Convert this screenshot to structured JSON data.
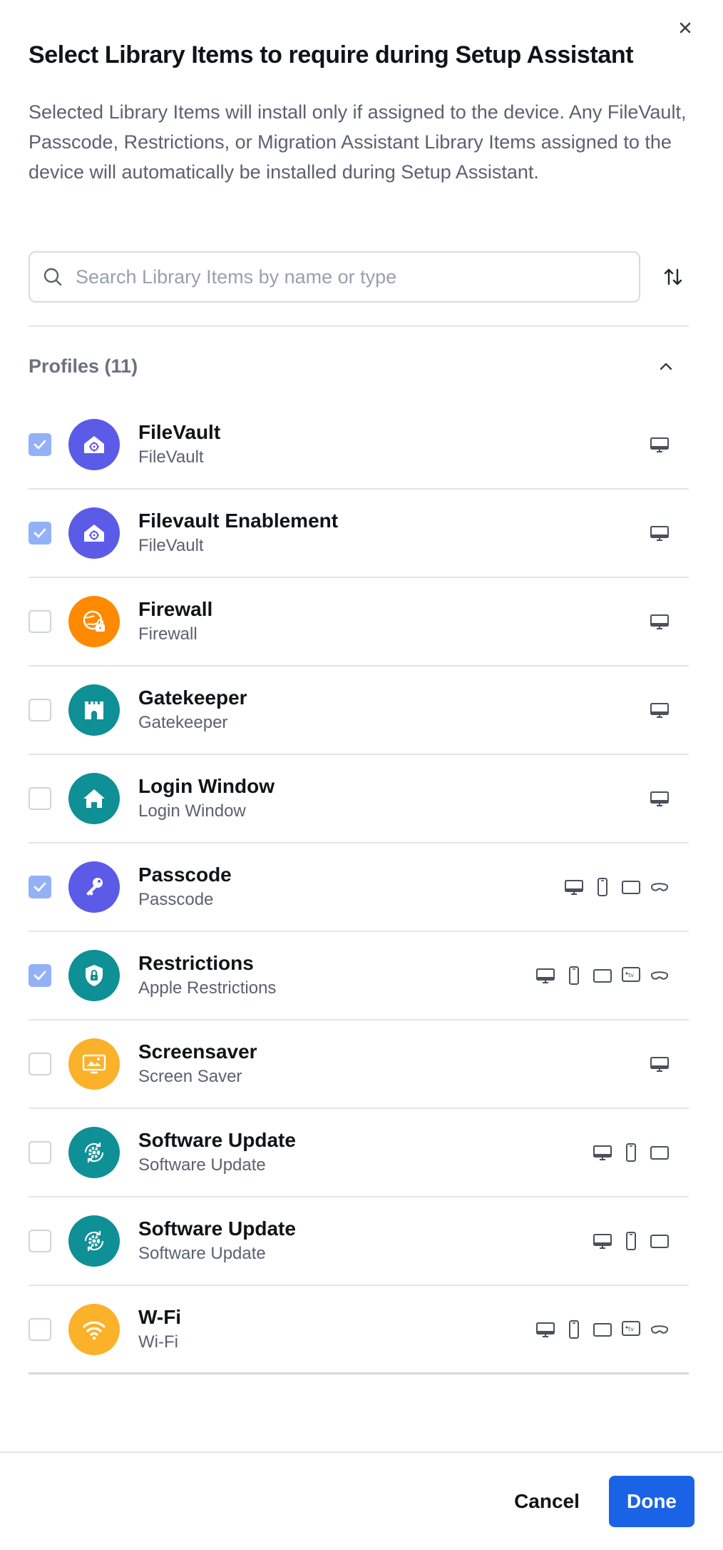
{
  "dialog": {
    "title": "Select Library Items to require during Setup Assistant",
    "description": "Selected Library Items will install only if assigned to the device. Any FileVault, Passcode, Restrictions, or Migration Assistant Library Items assigned to the device will automatically be installed during Setup Assistant.",
    "close_icon": "close-icon"
  },
  "search": {
    "placeholder": "Search Library Items by name or type",
    "value": "",
    "icon": "search-icon",
    "sort_icon": "sort-icon"
  },
  "section": {
    "title": "Profiles (11)",
    "expanded": true
  },
  "colors": {
    "purple": "#5b5be8",
    "orange": "#ff8a00",
    "teal": "#0f8f96",
    "yellow": "#fbb12a",
    "checked": "#93b1f6",
    "primary": "#1a63e6"
  },
  "items": [
    {
      "name": "FileVault",
      "type": "FileVault",
      "checked": true,
      "icon": "filevault-house-icon",
      "color": "#5b5be8",
      "devices": [
        "mac"
      ]
    },
    {
      "name": "Filevault Enablement",
      "type": "FileVault",
      "checked": true,
      "icon": "filevault-house-icon",
      "color": "#5b5be8",
      "devices": [
        "mac"
      ]
    },
    {
      "name": "Firewall",
      "type": "Firewall",
      "checked": false,
      "icon": "firewall-lock-icon",
      "color": "#ff8a00",
      "devices": [
        "mac"
      ]
    },
    {
      "name": "Gatekeeper",
      "type": "Gatekeeper",
      "checked": false,
      "icon": "castle-icon",
      "color": "#0f8f96",
      "devices": [
        "mac"
      ]
    },
    {
      "name": "Login Window",
      "type": "Login Window",
      "checked": false,
      "icon": "home-icon",
      "color": "#0f8f96",
      "devices": [
        "mac"
      ]
    },
    {
      "name": "Passcode",
      "type": "Passcode",
      "checked": true,
      "icon": "key-icon",
      "color": "#5b5be8",
      "devices": [
        "mac",
        "iphone",
        "ipad",
        "vision"
      ]
    },
    {
      "name": "Restrictions",
      "type": "Apple Restrictions",
      "checked": true,
      "icon": "shield-lock-icon",
      "color": "#0f8f96",
      "devices": [
        "mac",
        "iphone",
        "ipad",
        "tv",
        "vision"
      ]
    },
    {
      "name": "Screensaver",
      "type": "Screen Saver",
      "checked": false,
      "icon": "screensaver-icon",
      "color": "#fbb12a",
      "devices": [
        "mac"
      ]
    },
    {
      "name": "Software Update",
      "type": "Software Update",
      "checked": false,
      "icon": "gear-refresh-icon",
      "color": "#0f8f96",
      "devices": [
        "mac",
        "iphone",
        "ipad"
      ]
    },
    {
      "name": "Software Update",
      "type": "Software Update",
      "checked": false,
      "icon": "gear-refresh-icon",
      "color": "#0f8f96",
      "devices": [
        "mac",
        "iphone",
        "ipad"
      ]
    },
    {
      "name": "W-Fi",
      "type": "Wi-Fi",
      "checked": false,
      "icon": "wifi-icon",
      "color": "#fbb12a",
      "devices": [
        "mac",
        "iphone",
        "ipad",
        "tv",
        "vision"
      ]
    }
  ],
  "footer": {
    "cancel_label": "Cancel",
    "done_label": "Done"
  }
}
